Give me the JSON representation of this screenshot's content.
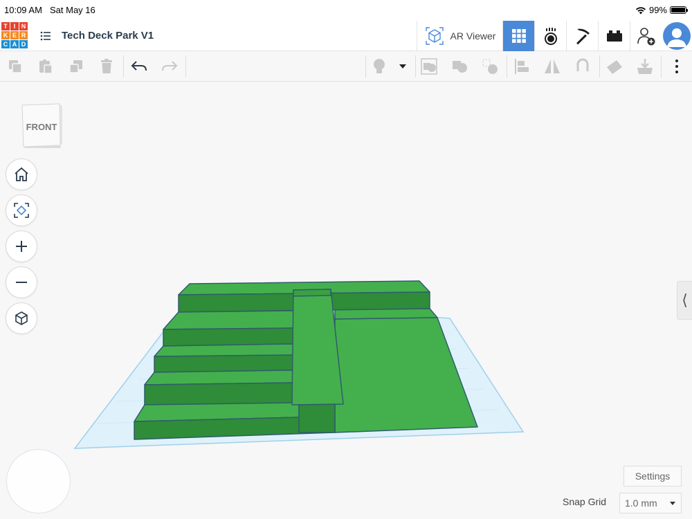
{
  "status_bar": {
    "time": "10:09 AM",
    "date": "Sat May 16",
    "battery": "99%",
    "battery_level": 0.99
  },
  "app": {
    "logo_letters": [
      "T",
      "I",
      "N",
      "K",
      "E",
      "R",
      "C",
      "A",
      "D"
    ],
    "logo_colors": [
      "#e5432e",
      "#e5432e",
      "#e5432e",
      "#f58a1f",
      "#f58a1f",
      "#f58a1f",
      "#1b8fd2",
      "#1b8fd2",
      "#1b8fd2"
    ],
    "title": "Tech Deck Park V1",
    "ar_label": "AR Viewer"
  },
  "icons": {
    "menu": "list-icon",
    "ar": "ar-cube-icon",
    "grid": "3d-design-grid-icon",
    "sim": "sim-lab-icon",
    "blocks": "pickaxe-icon",
    "bricks": "brick-icon",
    "add_user": "add-user-icon",
    "avatar": "user-avatar-icon"
  },
  "toolbar": {
    "items": [
      "copy-icon",
      "paste-icon",
      "duplicate-icon",
      "delete-icon",
      "undo-icon",
      "redo-icon",
      "lightbulb-icon",
      "dropdown-icon",
      "group-icon",
      "ungroup-icon",
      "hole-solid-icon",
      "align-icon",
      "mirror-icon",
      "workplane-magnet-icon",
      "ruler-icon",
      "import-icon",
      "more-icon"
    ]
  },
  "viewcube": {
    "face_label": "FRONT"
  },
  "nav": [
    "home-view-icon",
    "fit-view-icon",
    "zoom-in-icon",
    "zoom-out-icon",
    "ortho-view-icon"
  ],
  "panel_toggle": "⟨",
  "settings_label": "Settings",
  "snap_grid": {
    "label": "Snap Grid",
    "value": "1.0 mm"
  },
  "colors": {
    "accent": "#4a88d8",
    "shape_green": "#3fae49",
    "shape_green_dark": "#2d8a38",
    "workplane": "#cfeaf7"
  }
}
